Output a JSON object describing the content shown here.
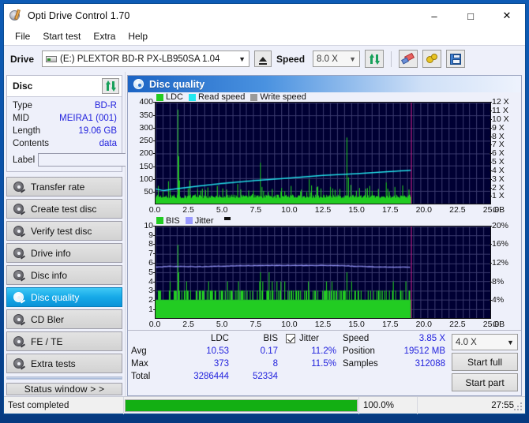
{
  "window": {
    "title": "Opti Drive Control 1.70",
    "icon": "disc-pen-icon",
    "minimize": "–",
    "maximize": "□",
    "close": "✕"
  },
  "menubar": {
    "items": [
      "File",
      "Start test",
      "Extra",
      "Help"
    ]
  },
  "toolbar": {
    "drive_label": "Drive",
    "drive_value": "(E:)  PLEXTOR BD-R  PX-LB950SA 1.04",
    "eject_icon": "eject-icon",
    "speed_label": "Speed",
    "speed_value": "8.0 X",
    "refresh_icon": "refresh-icon",
    "erase_icon": "erase-icon",
    "settings_icon": "gear-icon",
    "save_icon": "save-icon"
  },
  "sidebar": {
    "disc_panel": {
      "title": "Disc",
      "refresh_icon": "refresh-icon",
      "rows": [
        {
          "key": "Type",
          "value": "BD-R"
        },
        {
          "key": "MID",
          "value": "MEIRA1 (001)"
        },
        {
          "key": "Length",
          "value": "19.06 GB"
        },
        {
          "key": "Contents",
          "value": "data"
        }
      ],
      "label_key": "Label",
      "label_value": "",
      "label_placeholder": "",
      "label_button_icon": "disc-icon"
    },
    "nav": [
      {
        "label": "Transfer rate",
        "active": false
      },
      {
        "label": "Create test disc",
        "active": false
      },
      {
        "label": "Verify test disc",
        "active": false
      },
      {
        "label": "Drive info",
        "active": false
      },
      {
        "label": "Disc info",
        "active": false
      },
      {
        "label": "Disc quality",
        "active": true
      },
      {
        "label": "CD Bler",
        "active": false
      },
      {
        "label": "FE / TE",
        "active": false
      },
      {
        "label": "Extra tests",
        "active": false
      }
    ],
    "status_window_button": "Status window > >"
  },
  "panel": {
    "title": "Disc quality",
    "icon": "disc-icon"
  },
  "stats": {
    "columns": [
      "LDC",
      "BIS"
    ],
    "rows": [
      {
        "label": "Avg",
        "ldc": "10.53",
        "bis": "0.17",
        "jitter": "11.2%"
      },
      {
        "label": "Max",
        "ldc": "373",
        "bis": "8",
        "jitter": "11.5%"
      },
      {
        "label": "Total",
        "ldc": "3286444",
        "bis": "52334",
        "jitter": ""
      }
    ],
    "jitter_label": "Jitter",
    "jitter_checked": true,
    "speed_key": "Speed",
    "speed_value": "3.85 X",
    "position_key": "Position",
    "position_value": "19512 MB",
    "samples_key": "Samples",
    "samples_value": "312088",
    "speed_select": "4.0 X",
    "start_full": "Start full",
    "start_part": "Start part"
  },
  "statusbar": {
    "message": "Test completed",
    "progress_percent": 100.0,
    "progress_text": "100.0%",
    "elapsed": "27:55"
  },
  "colors": {
    "ldc_green": "#22cc22",
    "read_speed_cyan": "#22e8f0",
    "write_speed_gray": "#9a9a9a",
    "bis_green": "#22cc22",
    "jitter_violet": "#9a9aff",
    "plot_bg": "#000033",
    "grid": "#3a3a6e",
    "end_marker": "#cc1f8a",
    "accent_blue": "#2222dd",
    "progress_green": "#13af13",
    "active_nav": "#16a9e8"
  },
  "chart_data": [
    {
      "type": "line",
      "name": "disc-quality-ldc-chart",
      "title": "",
      "xlabel": "GB",
      "ylabel": "LDC",
      "xlim": [
        0.0,
        25.0
      ],
      "ylim": [
        0,
        400
      ],
      "y2lim": [
        0,
        12
      ],
      "y2label": "X",
      "grid": true,
      "legend": [
        "LDC",
        "Read speed",
        "Write speed"
      ],
      "legend_position": "top-left",
      "xticks": [
        "0.0",
        "2.5",
        "5.0",
        "7.5",
        "10.0",
        "12.5",
        "15.0",
        "17.5",
        "20.0",
        "22.5",
        "25.0"
      ],
      "yticks": [
        400,
        350,
        300,
        250,
        200,
        150,
        100,
        50
      ],
      "y2ticks": [
        "12 X",
        "11 X",
        "10 X",
        "9 X",
        "8 X",
        "7 X",
        "6 X",
        "5 X",
        "4 X",
        "3 X",
        "2 X",
        "1 X"
      ],
      "data_end_gb": 19.06,
      "series": [
        {
          "name": "LDC",
          "color": "#22cc22",
          "kind": "impulse",
          "baseline": 22,
          "noise": 14,
          "spikes": [
            {
              "x": 0.15,
              "y": 70
            },
            {
              "x": 0.55,
              "y": 48
            },
            {
              "x": 1.05,
              "y": 52
            },
            {
              "x": 1.62,
              "y": 372
            },
            {
              "x": 1.7,
              "y": 188
            },
            {
              "x": 1.78,
              "y": 92
            },
            {
              "x": 2.4,
              "y": 60
            },
            {
              "x": 3.1,
              "y": 58
            },
            {
              "x": 3.85,
              "y": 64
            },
            {
              "x": 4.55,
              "y": 70
            },
            {
              "x": 5.3,
              "y": 56
            },
            {
              "x": 6.1,
              "y": 78
            },
            {
              "x": 6.95,
              "y": 52
            },
            {
              "x": 7.8,
              "y": 162
            },
            {
              "x": 7.95,
              "y": 66
            },
            {
              "x": 8.7,
              "y": 58
            },
            {
              "x": 9.4,
              "y": 62
            },
            {
              "x": 10.1,
              "y": 70
            },
            {
              "x": 10.85,
              "y": 54
            },
            {
              "x": 11.45,
              "y": 96
            },
            {
              "x": 11.6,
              "y": 72
            },
            {
              "x": 12.3,
              "y": 60
            },
            {
              "x": 13.05,
              "y": 66
            },
            {
              "x": 13.75,
              "y": 58
            },
            {
              "x": 14.25,
              "y": 262
            },
            {
              "x": 14.4,
              "y": 104
            },
            {
              "x": 14.55,
              "y": 74
            },
            {
              "x": 15.2,
              "y": 62
            },
            {
              "x": 15.95,
              "y": 70
            },
            {
              "x": 16.6,
              "y": 58
            },
            {
              "x": 17.2,
              "y": 84
            },
            {
              "x": 17.85,
              "y": 66
            },
            {
              "x": 18.45,
              "y": 72
            },
            {
              "x": 18.9,
              "y": 56
            }
          ]
        },
        {
          "name": "Read speed",
          "color": "#22e8f0",
          "kind": "line",
          "points": [
            {
              "x": 0.0,
              "y": 1.75
            },
            {
              "x": 0.6,
              "y": 1.55
            },
            {
              "x": 1.5,
              "y": 1.75
            },
            {
              "x": 3.0,
              "y": 2.05
            },
            {
              "x": 5.0,
              "y": 2.4
            },
            {
              "x": 7.5,
              "y": 2.75
            },
            {
              "x": 10.0,
              "y": 3.05
            },
            {
              "x": 12.5,
              "y": 3.35
            },
            {
              "x": 15.0,
              "y": 3.55
            },
            {
              "x": 17.0,
              "y": 3.75
            },
            {
              "x": 19.06,
              "y": 3.95
            }
          ]
        },
        {
          "name": "Write speed",
          "color": "#9a9a9a",
          "kind": "none",
          "points": []
        }
      ]
    },
    {
      "type": "line",
      "name": "disc-quality-bis-chart",
      "title": "",
      "xlabel": "GB",
      "ylabel": "BIS",
      "xlim": [
        0.0,
        25.0
      ],
      "ylim": [
        0,
        10
      ],
      "y2lim": [
        0,
        20
      ],
      "y2label": "%",
      "grid": true,
      "legend": [
        "BIS",
        "Jitter"
      ],
      "legend_position": "top-left",
      "xticks": [
        "0.0",
        "2.5",
        "5.0",
        "7.5",
        "10.0",
        "12.5",
        "15.0",
        "17.5",
        "20.0",
        "22.5",
        "25.0"
      ],
      "yticks": [
        10,
        9,
        8,
        7,
        6,
        5,
        4,
        3,
        2,
        1
      ],
      "y2ticks": [
        "20%",
        "16%",
        "12%",
        "8%",
        "4%"
      ],
      "data_end_gb": 19.06,
      "series": [
        {
          "name": "BIS",
          "color": "#22cc22",
          "kind": "impulse",
          "baseline": 2,
          "spike_level_common": 3,
          "spikes": [
            {
              "x": 1.62,
              "y": 8
            },
            {
              "x": 1.7,
              "y": 5
            },
            {
              "x": 3.95,
              "y": 4
            },
            {
              "x": 5.35,
              "y": 4
            },
            {
              "x": 6.15,
              "y": 4
            },
            {
              "x": 7.8,
              "y": 5
            },
            {
              "x": 8.45,
              "y": 5
            },
            {
              "x": 8.7,
              "y": 4
            },
            {
              "x": 9.05,
              "y": 4
            },
            {
              "x": 9.35,
              "y": 4
            },
            {
              "x": 11.4,
              "y": 4
            },
            {
              "x": 14.25,
              "y": 5
            },
            {
              "x": 14.6,
              "y": 4
            },
            {
              "x": 17.75,
              "y": 4
            }
          ]
        },
        {
          "name": "Jitter",
          "color": "#9a9aff",
          "kind": "line",
          "points": [
            {
              "x": 0.0,
              "y": 11.1
            },
            {
              "x": 1.0,
              "y": 11.3
            },
            {
              "x": 3.0,
              "y": 11.2
            },
            {
              "x": 5.5,
              "y": 11.4
            },
            {
              "x": 8.0,
              "y": 11.5
            },
            {
              "x": 11.0,
              "y": 11.5
            },
            {
              "x": 13.5,
              "y": 11.5
            },
            {
              "x": 15.0,
              "y": 11.3
            },
            {
              "x": 16.5,
              "y": 11.2
            },
            {
              "x": 18.0,
              "y": 11.1
            },
            {
              "x": 19.06,
              "y": 11.1
            }
          ]
        }
      ]
    }
  ]
}
